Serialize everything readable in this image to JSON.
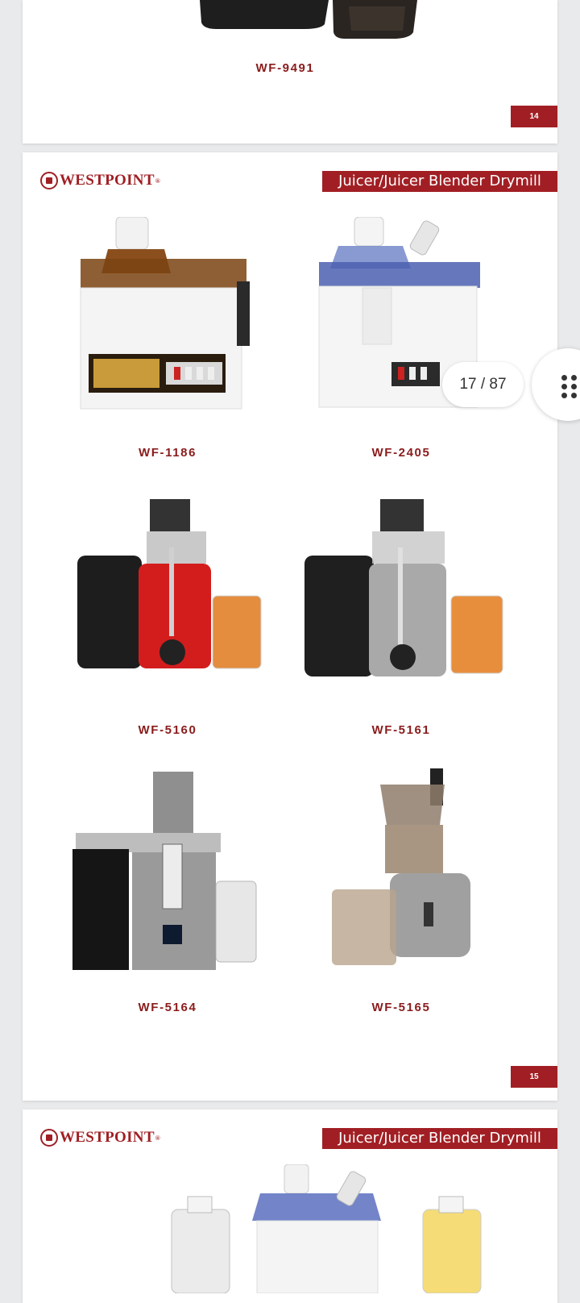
{
  "viewer": {
    "page_indicator": "17 / 87",
    "grid_button_icon": "grid-dots-icon"
  },
  "pages": [
    {
      "models": [
        "WF-9491"
      ],
      "page_number": "14"
    },
    {
      "brand": "WESTPOINT",
      "brand_mark": "®",
      "category": "Juicer/Juicer Blender Drymill",
      "models": [
        "WF-1186",
        "WF-2405",
        "WF-5160",
        "WF-5161",
        "WF-5164",
        "WF-5165"
      ],
      "page_number": "15"
    },
    {
      "brand": "WESTPOINT",
      "brand_mark": "®",
      "category": "Juicer/Juicer Blender Drymill"
    }
  ],
  "colors": {
    "brand_red": "#a11f24",
    "label_red": "#8a1c1c",
    "background": "#e9eaec"
  }
}
